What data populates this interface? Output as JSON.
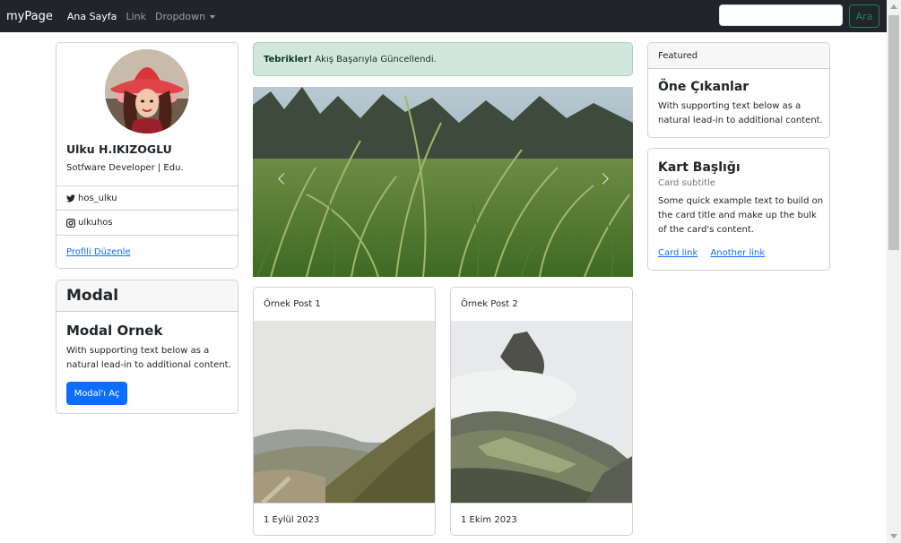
{
  "navbar": {
    "brand": "myPage",
    "links": [
      "Ana Sayfa",
      "Link",
      "Dropdown"
    ],
    "search_placeholder": "",
    "search_button": "Ara"
  },
  "profile": {
    "name": "Ulku H.IKIZOGLU",
    "title": "Sotfware Developer | Edu.",
    "twitter": "hos_ulku",
    "instagram": "ulkuhos",
    "edit_link": "Profili Düzenle"
  },
  "modal_card": {
    "header": "Modal",
    "title": "Modal Ornek",
    "text": "With supporting text below as a natural lead-in to additional content.",
    "button": "Modal'ı Aç"
  },
  "alert": {
    "strong": "Tebrikler!",
    "text": "Akış Başarıyla Güncellendi."
  },
  "posts": [
    {
      "title": "Örnek Post 1",
      "date": "1 Eylül 2023"
    },
    {
      "title": "Örnek Post 2",
      "date": "1 Ekim 2023"
    }
  ],
  "featured": {
    "header": "Featured",
    "title": "Öne Çıkanlar",
    "text": "With supporting text below as a natural lead-in to additional content."
  },
  "info_card": {
    "title": "Kart Başlığı",
    "subtitle": "Card subtitle",
    "text": "Some quick example text to build on the card title and make up the bulk of the card's content.",
    "link1": "Card link",
    "link2": "Another link"
  },
  "colors": {
    "navbar": "#212529",
    "primary": "#0d6efd",
    "success": "#198754",
    "alert_bg": "#d1e7dd"
  }
}
